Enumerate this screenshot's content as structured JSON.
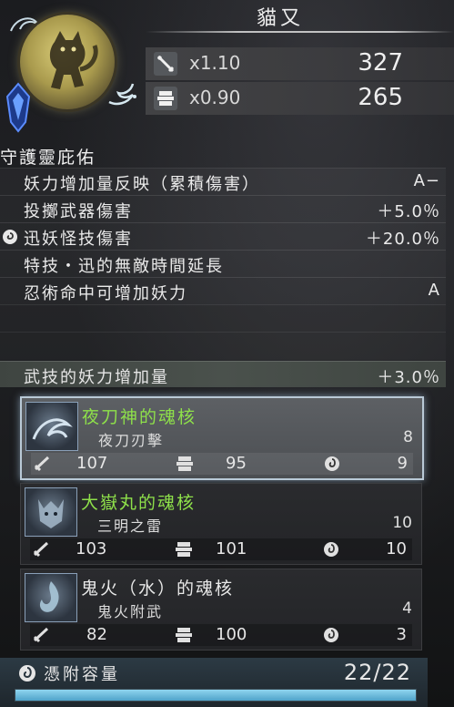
{
  "header": {
    "spirit_name": "貓又"
  },
  "stats": [
    {
      "icon": "sword-icon",
      "multiplier": "x1.10",
      "value": "327"
    },
    {
      "icon": "armor-icon",
      "multiplier": "x0.90",
      "value": "265"
    }
  ],
  "section_title": "守護靈庇佑",
  "attributes": [
    {
      "name": "妖力增加量反映（累積傷害）",
      "value": "A−"
    },
    {
      "name": "投擲武器傷害",
      "value": "＋5.0％"
    },
    {
      "name": "迅妖怪技傷害",
      "value": "＋20.0％"
    },
    {
      "name": "特技・迅的無敵時間延長",
      "value": ""
    },
    {
      "name": "忍術命中可增加妖力",
      "value": "A"
    }
  ],
  "bonus": {
    "name": "武技的妖力增加量",
    "value": "＋3.0％"
  },
  "cores": [
    {
      "name": "夜刀神的魂核",
      "skill": "夜刀刃擊",
      "cost": "8",
      "attack": "107",
      "defense": "95",
      "capacity": "9",
      "name_color": "green"
    },
    {
      "name": "大嶽丸的魂核",
      "skill": "三明之雷",
      "cost": "10",
      "attack": "103",
      "defense": "101",
      "capacity": "10",
      "name_color": "green"
    },
    {
      "name": "鬼火（水）的魂核",
      "skill": "鬼火附武",
      "cost": "4",
      "attack": "82",
      "defense": "100",
      "capacity": "3",
      "name_color": "white"
    }
  ],
  "capacity": {
    "label": "憑附容量",
    "value": "22/22",
    "fill": 1.0
  },
  "colors": {
    "green_name": "#8ee04a",
    "bar": "#6cc0e2",
    "selected_border": "#b9c9d6"
  }
}
